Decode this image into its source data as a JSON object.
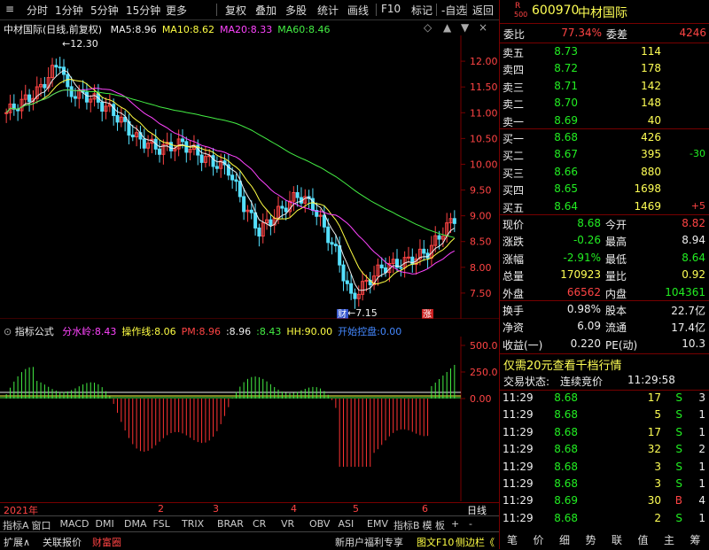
{
  "toolbar": {
    "items": [
      "分时",
      "1分钟",
      "5分钟",
      "15分钟",
      "更多",
      "复权",
      "叠加",
      "多股",
      "统计",
      "画线",
      "F10",
      "标记",
      "-自选",
      "返回"
    ]
  },
  "main": {
    "stock_label": "中材国际(日线,前复权)",
    "ma": [
      {
        "name": "MA5",
        "value": "8.96",
        "color": "#eeeeee"
      },
      {
        "name": "MA10",
        "value": "8.62",
        "color": "#ffff44"
      },
      {
        "name": "MA20",
        "value": "8.33",
        "color": "#ff44ff"
      },
      {
        "name": "MA60",
        "value": "8.46",
        "color": "#44ee44"
      }
    ],
    "high_label": "12.30",
    "low_label": "7.15",
    "marker_cai": "财",
    "marker_zhang": "涨",
    "price_ticks": [
      "12.00",
      "11.50",
      "11.00",
      "10.50",
      "10.00",
      "9.50",
      "9.00",
      "8.50",
      "8.00",
      "7.50"
    ]
  },
  "indicator": {
    "title": "指标公式",
    "params": [
      {
        "name": "分水岭",
        "value": "8.43",
        "color": "#ff44ff"
      },
      {
        "name": "操作线",
        "value": "8.06",
        "color": "#ffff44"
      },
      {
        "name": "PM",
        "value": "8.96",
        "color": "#ff4444"
      },
      {
        "name": "",
        "value": "8.96",
        "color": "#eeeeee"
      },
      {
        "name": "",
        "value": "8.43",
        "color": "#44ee44"
      },
      {
        "name": "HH",
        "value": "90.00",
        "color": "#ffff44"
      },
      {
        "name": "开始控盘",
        "value": "0.00",
        "color": "#4488ff"
      }
    ],
    "ticks": [
      "500.0",
      "250.0",
      "0.00"
    ]
  },
  "time_axis": {
    "year": "2021年",
    "months": [
      "2",
      "3",
      "4",
      "5",
      "6"
    ],
    "right_label": "日线"
  },
  "bottom_tabs": [
    "指标A",
    "窗口",
    "MACD",
    "DMI",
    "DMA",
    "FSL",
    "TRIX",
    "BRAR",
    "CR",
    "VR",
    "OBV",
    "ASI",
    "EMV",
    "指标B",
    "模 板",
    "+",
    "-"
  ],
  "status_bar": {
    "left": [
      "扩展∧",
      "关联报价",
      "财富圈"
    ],
    "right": [
      "新用户福利专享",
      "图文F10",
      "侧边栏《"
    ]
  },
  "right_buttons": [
    "笔",
    "价",
    "细",
    "势",
    "联",
    "值",
    "主",
    "筹"
  ],
  "quote": {
    "code": "600970",
    "name": "中材国际",
    "rz_badge": "R",
    "badge_num": "500",
    "wei_bi_label": "委比",
    "wei_bi": "77.34%",
    "wei_cha_label": "委差",
    "wei_cha": "4246",
    "asks": [
      {
        "label": "卖五",
        "price": "8.73",
        "vol": "114"
      },
      {
        "label": "卖四",
        "price": "8.72",
        "vol": "178"
      },
      {
        "label": "卖三",
        "price": "8.71",
        "vol": "142"
      },
      {
        "label": "卖二",
        "price": "8.70",
        "vol": "148"
      },
      {
        "label": "卖一",
        "price": "8.69",
        "vol": "40"
      }
    ],
    "bids": [
      {
        "label": "买一",
        "price": "8.68",
        "vol": "426",
        "chg": ""
      },
      {
        "label": "买二",
        "price": "8.67",
        "vol": "395",
        "chg": "-30"
      },
      {
        "label": "买三",
        "price": "8.66",
        "vol": "880",
        "chg": ""
      },
      {
        "label": "买四",
        "price": "8.65",
        "vol": "1698",
        "chg": ""
      },
      {
        "label": "买五",
        "price": "8.64",
        "vol": "1469",
        "chg": "+5"
      }
    ],
    "stats": [
      {
        "l1": "现价",
        "v1": "8.68",
        "l2": "今开",
        "v2": "8.82"
      },
      {
        "l1": "涨跌",
        "v1": "-0.26",
        "l2": "最高",
        "v2": "8.94"
      },
      {
        "l1": "涨幅",
        "v1": "-2.91%",
        "l2": "最低",
        "v2": "8.64"
      },
      {
        "l1": "总量",
        "v1": "170923",
        "l2": "量比",
        "v2": "0.92"
      },
      {
        "l1": "外盘",
        "v1": "66562",
        "l2": "内盘",
        "v2": "104361"
      }
    ],
    "stats2": [
      {
        "l1": "换手",
        "v1": "0.98%",
        "l2": "股本",
        "v2": "22.7亿"
      },
      {
        "l1": "净资",
        "v1": "6.09",
        "l2": "流通",
        "v2": "17.4亿"
      },
      {
        "l1": "收益(一)",
        "v1": "0.220",
        "l2": "PE(动)",
        "v2": "10.3"
      }
    ],
    "promo": "仅需20元查看千档行情",
    "trade_state_label": "交易状态:",
    "trade_state": "连续竞价",
    "trade_time": "11:29:58",
    "ticks": [
      {
        "time": "11:29",
        "price": "8.68",
        "vol": "17",
        "side": "S",
        "n": "3"
      },
      {
        "time": "11:29",
        "price": "8.68",
        "vol": "5",
        "side": "S",
        "n": "1"
      },
      {
        "time": "11:29",
        "price": "8.68",
        "vol": "17",
        "side": "S",
        "n": "1"
      },
      {
        "time": "11:29",
        "price": "8.68",
        "vol": "32",
        "side": "S",
        "n": "2"
      },
      {
        "time": "11:29",
        "price": "8.68",
        "vol": "3",
        "side": "S",
        "n": "1"
      },
      {
        "time": "11:29",
        "price": "8.68",
        "vol": "3",
        "side": "S",
        "n": "1"
      },
      {
        "time": "11:29",
        "price": "8.69",
        "vol": "30",
        "side": "B",
        "n": "4"
      },
      {
        "time": "11:29",
        "price": "8.68",
        "vol": "2",
        "side": "S",
        "n": "1"
      }
    ]
  }
}
